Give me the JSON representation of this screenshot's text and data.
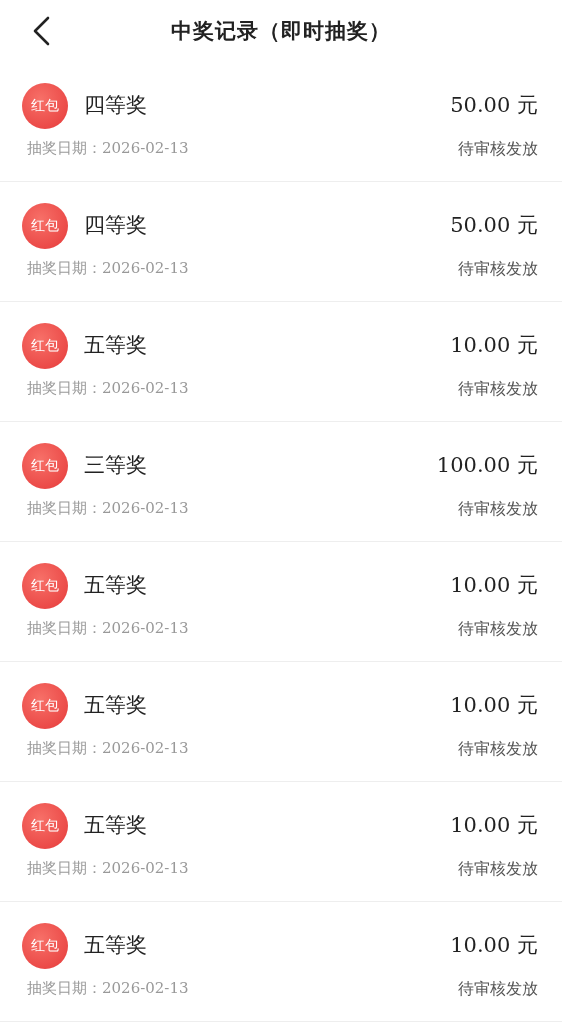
{
  "header": {
    "title": "中奖记录（即时抽奖）"
  },
  "records": [
    {
      "badge": "红包",
      "prize": "四等奖",
      "amount": "50.00 元",
      "date": "抽奖日期：2026-02-13",
      "status": "待审核发放"
    },
    {
      "badge": "红包",
      "prize": "四等奖",
      "amount": "50.00 元",
      "date": "抽奖日期：2026-02-13",
      "status": "待审核发放"
    },
    {
      "badge": "红包",
      "prize": "五等奖",
      "amount": "10.00 元",
      "date": "抽奖日期：2026-02-13",
      "status": "待审核发放"
    },
    {
      "badge": "红包",
      "prize": "三等奖",
      "amount": "100.00 元",
      "date": "抽奖日期：2026-02-13",
      "status": "待审核发放"
    },
    {
      "badge": "红包",
      "prize": "五等奖",
      "amount": "10.00 元",
      "date": "抽奖日期：2026-02-13",
      "status": "待审核发放"
    },
    {
      "badge": "红包",
      "prize": "五等奖",
      "amount": "10.00 元",
      "date": "抽奖日期：2026-02-13",
      "status": "待审核发放"
    },
    {
      "badge": "红包",
      "prize": "五等奖",
      "amount": "10.00 元",
      "date": "抽奖日期：2026-02-13",
      "status": "待审核发放"
    },
    {
      "badge": "红包",
      "prize": "五等奖",
      "amount": "10.00 元",
      "date": "抽奖日期：2026-02-13",
      "status": "待审核发放"
    }
  ]
}
